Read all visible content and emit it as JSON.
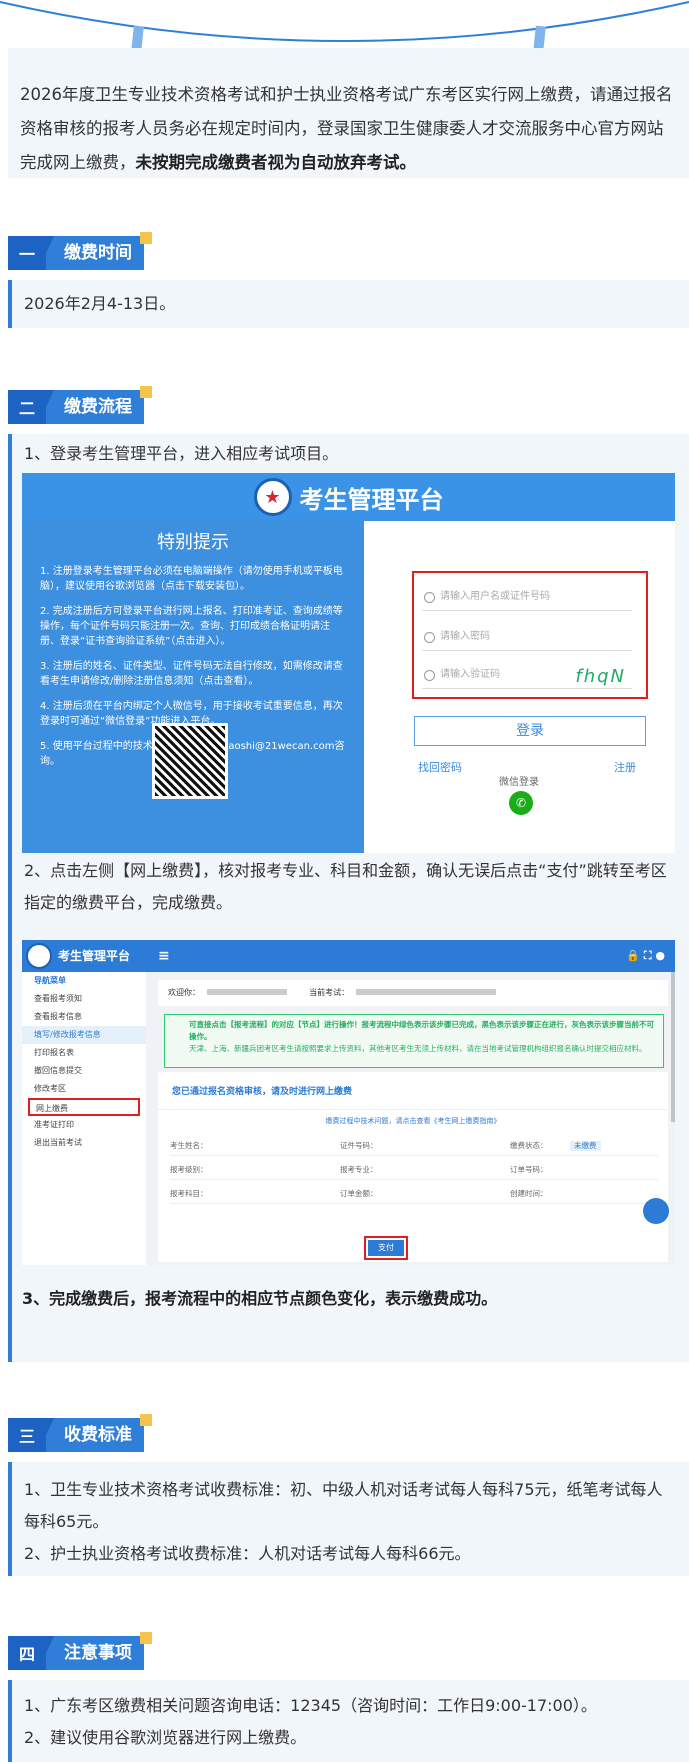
{
  "intro": {
    "text": "2026年度卫生专业技术资格考试和护士执业资格考试广东考区实行网上缴费，请通过报名资格审核的报考人员务必在规定时间内，登录国家卫生健康委人才交流服务中心官方网站完成网上缴费，",
    "bold": "未按期完成缴费者视为自动放弃考试。"
  },
  "sections": {
    "s1": {
      "num": "一",
      "title": "缴费时间",
      "line": "2026年2月4-13日。"
    },
    "s2": {
      "num": "二",
      "title": "缴费流程",
      "step1": "1、登录考生管理平台，进入相应考试项目。",
      "step2": "2、点击左侧【网上缴费】，核对报考专业、科目和金额，确认无误后点击“支付”跳转至考区指定的缴费平台，完成缴费。",
      "step3": "3、完成缴费后，报考流程中的相应节点颜色变化，表示缴费成功。"
    },
    "s3": {
      "num": "三",
      "title": "收费标准",
      "line1": "1、卫生专业技术资格考试收费标准：初、中级人机对话考试每人每科75元，纸笔考试每人每科65元。",
      "line2": "2、护士执业资格考试收费标准：人机对话考试每人每科66元。"
    },
    "s4": {
      "num": "四",
      "title": "注意事项",
      "line1": "1、广东考区缴费相关问题咨询电话：12345（咨询时间：工作日9:00-17:00）。",
      "line2": "2、建议使用谷歌浏览器进行网上缴费。"
    }
  },
  "shot1": {
    "header": "考生管理平台",
    "tips_title": "特别提示",
    "tips": [
      "1. 注册登录考生管理平台必须在电脑端操作（请勿使用手机或平板电脑），建议使用谷歌浏览器（点击下载安装包）。",
      "2. 完成注册后方可登录平台进行网上报名、打印准考证、查询成绩等操作，每个证件号码只能注册一次。查询、打印成绩合格证明请注册、登录“证书查询验证系统”（点击进入）。",
      "3. 注册后的姓名、证件类型、证件号码无法自行修改，如需修改请查看考生申请修改/删除注册信息须知（点击查看）。",
      "4. 注册后须在平台内绑定个人微信号，用于接收考试重要信息，再次登录时可通过“微信登录”功能进入平台。",
      "5. 使用平台过程中的技术问题可发邮件至kaoshi@21wecan.com咨询。"
    ],
    "username_placeholder": "请输入用户名或证件号码",
    "password_placeholder": "请输入密码",
    "captcha_placeholder": "请输入验证码",
    "captcha_text": "fhqN",
    "login_button": "登录",
    "forgot": "找回密码",
    "register": "注册",
    "wechat_login": "微信登录"
  },
  "shot2": {
    "title": "考生管理平台",
    "menu_icon": "≡",
    "nav_title": "导航菜单",
    "menu": [
      "查看报考须知",
      "查看报考信息",
      "填写/修改报考信息",
      "打印报名表",
      "撤回信息提交",
      "修改考区",
      "网上缴费",
      "准考证打印",
      "退出当前考试"
    ],
    "welcome": "欢迎你：",
    "current_exam": "当前考试：",
    "notice1": "可直接点击【报考流程】的对应【节点】进行操作！报考流程中绿色表示该步骤已完成，黑色表示该步骤正在进行，灰色表示该步骤当前不可操作。",
    "notice2": "天津、上海、新疆兵团考区考生请按照要求上传资料，其他考区考生无须上传材料，请在当地考试管理机构组织报名确认时提交相应材料。",
    "panel_title": "您已通过报名资格审核，请及时进行网上缴费",
    "payment_hint": "缴费过程中技术问题，请点击查看《考生网上缴费指南》",
    "fields": [
      "考生姓名：",
      "证件号码：",
      "缴费状态：",
      "报考级别：",
      "报考专业：",
      "订单号码：",
      "报考科目：",
      "订单金额：",
      "创建时间："
    ],
    "status": "未缴费",
    "pay_button": "支付"
  }
}
